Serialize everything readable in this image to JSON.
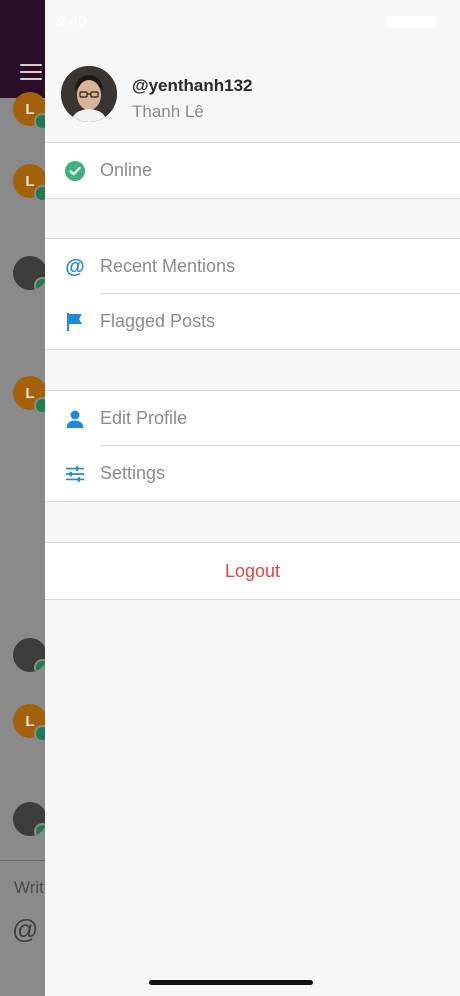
{
  "status_bar": {
    "time": "9:40"
  },
  "user": {
    "username": "@yenthanh132",
    "full_name": "Thanh Lê"
  },
  "status": {
    "label": "Online",
    "color": "#3fb37f"
  },
  "menu": {
    "group1": [
      {
        "label": "Recent Mentions",
        "icon": "at-icon"
      },
      {
        "label": "Flagged Posts",
        "icon": "flag-icon"
      }
    ],
    "group2": [
      {
        "label": "Edit Profile",
        "icon": "person-icon"
      },
      {
        "label": "Settings",
        "icon": "sliders-icon"
      }
    ],
    "logout": "Logout"
  },
  "background": {
    "avatar_letter": "L",
    "composer_text": "Writ",
    "composer_at": "@"
  },
  "colors": {
    "accent": "#2389d7",
    "logout": "#e0443f",
    "topbar": "#2a0d27"
  }
}
